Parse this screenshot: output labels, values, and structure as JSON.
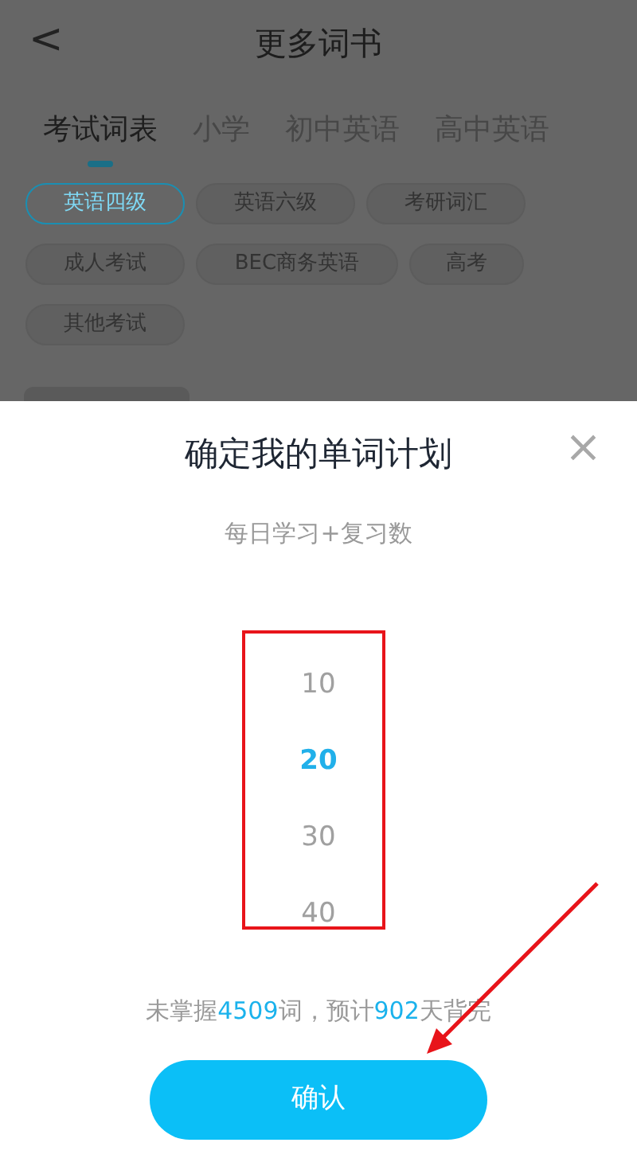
{
  "header": {
    "back": "<",
    "title": "更多词书"
  },
  "tabs": [
    {
      "label": "考试词表",
      "selected": true
    },
    {
      "label": "小学",
      "selected": false
    },
    {
      "label": "初中英语",
      "selected": false
    },
    {
      "label": "高中英语",
      "selected": false
    }
  ],
  "categories": [
    {
      "label": "英语四级",
      "selected": true
    },
    {
      "label": "英语六级",
      "selected": false
    },
    {
      "label": "考研词汇",
      "selected": false
    },
    {
      "label": "成人考试",
      "selected": false
    },
    {
      "label": "BEC商务英语",
      "selected": false
    },
    {
      "label": "高考",
      "selected": false
    },
    {
      "label": "其他考试",
      "selected": false
    }
  ],
  "dialog": {
    "title": "确定我的单词计划",
    "close": "×",
    "subtitle": "每日学习+复习数",
    "picker": [
      {
        "value": "10",
        "selected": false
      },
      {
        "value": "20",
        "selected": true
      },
      {
        "value": "30",
        "selected": false
      },
      {
        "value": "40",
        "selected": false
      }
    ],
    "summary": [
      {
        "text": "未掌握",
        "highlight": false
      },
      {
        "text": "4509",
        "highlight": true
      },
      {
        "text": "词，预计",
        "highlight": false
      },
      {
        "text": "902",
        "highlight": true
      },
      {
        "text": "天背完",
        "highlight": false
      }
    ],
    "confirm": "确认"
  }
}
